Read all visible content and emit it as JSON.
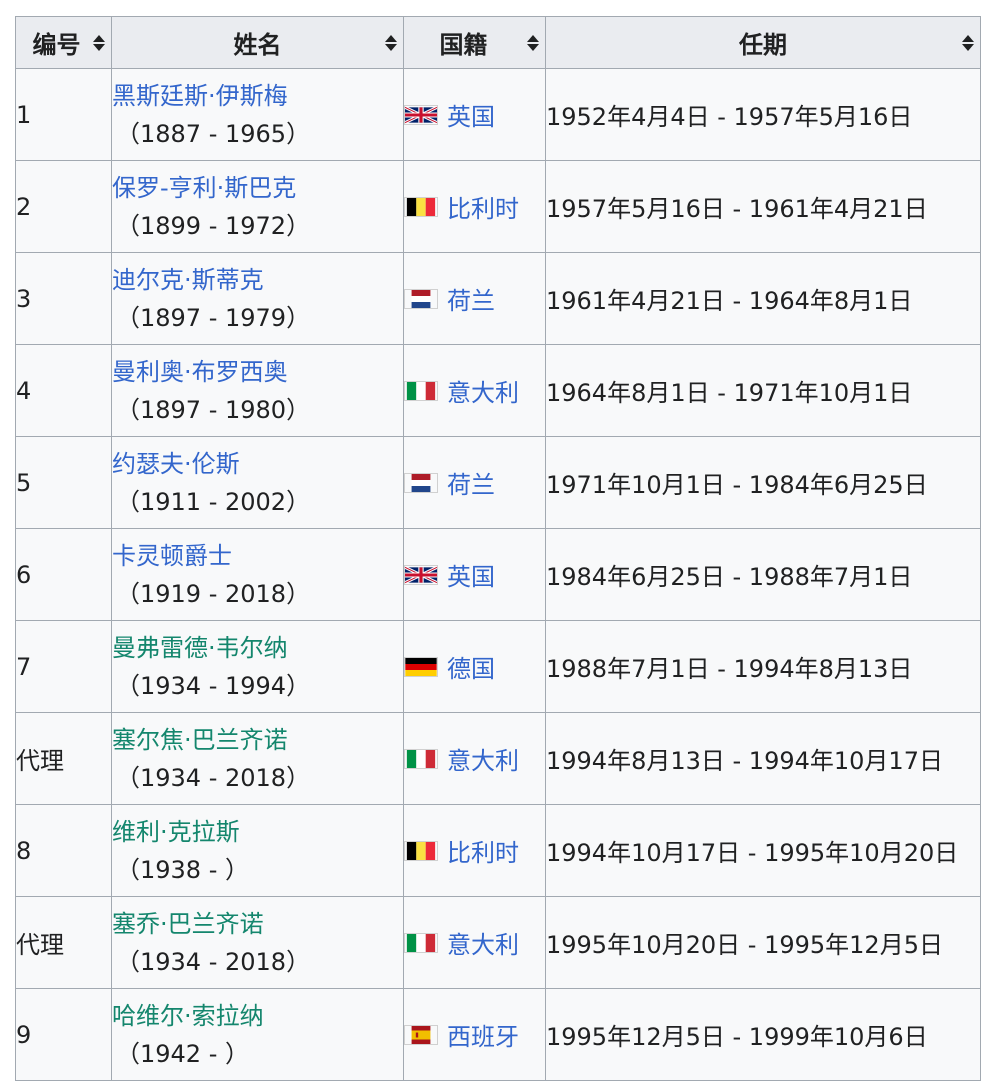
{
  "headers": {
    "num": "编号",
    "name": "姓名",
    "nationality": "国籍",
    "term": "任期"
  },
  "rows": [
    {
      "num": "1",
      "name": "黑斯廷斯·伊斯梅",
      "years": "（1887 - 1965）",
      "flag": "uk",
      "country": "英国",
      "term": "1952年4月4日 - 1957年5月16日"
    },
    {
      "num": "2",
      "name": "保罗-亨利·斯巴克",
      "years": "（1899 - 1972）",
      "flag": "belgium",
      "country": "比利时",
      "term": "1957年5月16日 - 1961年4月21日"
    },
    {
      "num": "3",
      "name": "迪尔克·斯蒂克",
      "years": "（1897 - 1979）",
      "flag": "netherlands",
      "country": "荷兰",
      "term": "1961年4月21日 - 1964年8月1日"
    },
    {
      "num": "4",
      "name": "曼利奥·布罗西奥",
      "years": "（1897 - 1980）",
      "flag": "italy",
      "country": "意大利",
      "term": "1964年8月1日 - 1971年10月1日"
    },
    {
      "num": "5",
      "name": "约瑟夫·伦斯",
      "years": "（1911 - 2002）",
      "flag": "netherlands",
      "country": "荷兰",
      "term": "1971年10月1日 - 1984年6月25日"
    },
    {
      "num": "6",
      "name": "卡灵顿爵士",
      "years": "（1919 - 2018）",
      "flag": "uk",
      "country": "英国",
      "term": "1984年6月25日 - 1988年7月1日"
    },
    {
      "num": "7",
      "name": "曼弗雷德·韦尔纳",
      "years": "（1934 - 1994）",
      "flag": "germany",
      "country": "德国",
      "term": "1988年7月1日 - 1994年8月13日"
    },
    {
      "num": "代理",
      "name": "塞尔焦·巴兰齐诺",
      "years": "（1934 - 2018）",
      "flag": "italy",
      "country": "意大利",
      "term": "1994年8月13日 - 1994年10月17日"
    },
    {
      "num": "8",
      "name": "维利·克拉斯",
      "years": "（1938 - ）",
      "flag": "belgium",
      "country": "比利时",
      "term": "1994年10月17日 - 1995年10月20日"
    },
    {
      "num": "代理",
      "name": "塞乔·巴兰齐诺",
      "years": "（1934 - 2018）",
      "flag": "italy",
      "country": "意大利",
      "term": "1995年10月20日 - 1995年12月5日"
    },
    {
      "num": "9",
      "name": "哈维尔·索拉纳",
      "years": "（1942 - ）",
      "flag": "spain",
      "country": "西班牙",
      "term": "1995年12月5日 - 1999年10月6日"
    }
  ],
  "colors": {
    "link": "#3366cc",
    "visited_link": "#14866d",
    "header_bg": "#eaecf0",
    "cell_bg": "#f8f9fa",
    "border": "#a2a9b1"
  }
}
